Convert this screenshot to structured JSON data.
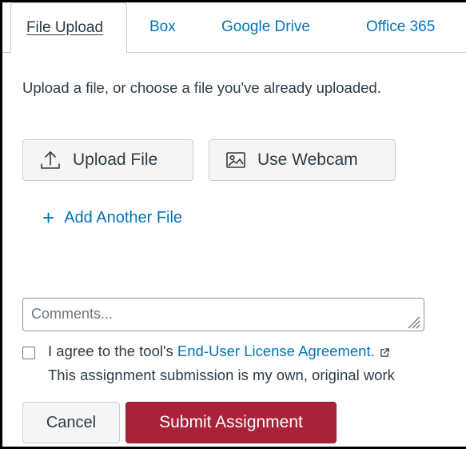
{
  "tabs": [
    {
      "label": "File Upload",
      "active": true
    },
    {
      "label": "Box"
    },
    {
      "label": "Google Drive"
    },
    {
      "label": "Office 365"
    }
  ],
  "instructions": "Upload a file, or choose a file you've already uploaded.",
  "buttons": {
    "upload_file": "Upload File",
    "use_webcam": "Use Webcam",
    "add_another_file": "Add Another File",
    "cancel": "Cancel",
    "submit": "Submit Assignment"
  },
  "comments": {
    "placeholder": "Comments...",
    "value": ""
  },
  "agreement": {
    "prefix": "I agree to the tool's ",
    "link": "End-User License Agreement.",
    "statement": "This assignment submission is my own, original work"
  },
  "icons": {
    "upload": "upload-icon",
    "webcam": "webcam-icon",
    "add": "plus-icon",
    "external_link": "external-link-icon",
    "resize": "resize-grip-icon"
  },
  "colors": {
    "link": "#0374b5",
    "text": "#2d3b45",
    "submit_bg": "#a8233a",
    "button_bg": "#f5f5f5",
    "border": "#c7cdd1"
  }
}
